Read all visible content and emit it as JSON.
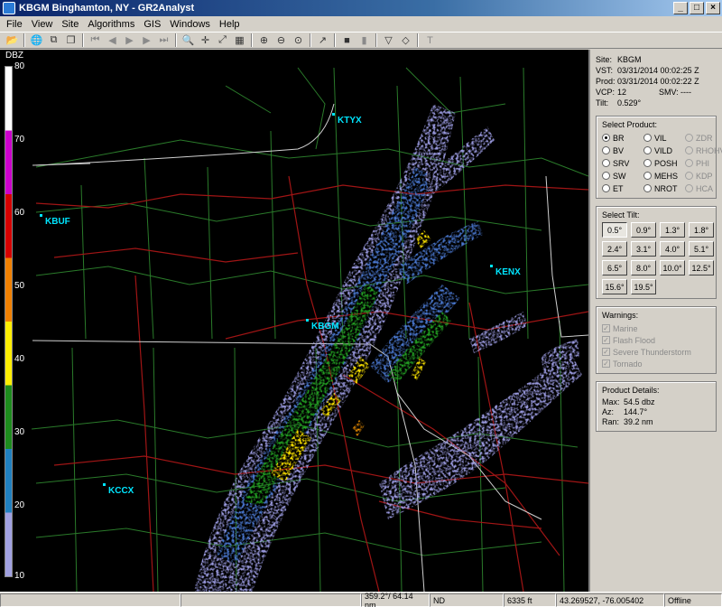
{
  "window": {
    "title": "KBGM Binghamton, NY - GR2Analyst",
    "minimize_glyph": "_",
    "maximize_glyph": "□",
    "close_glyph": "×"
  },
  "menu": [
    "File",
    "View",
    "Site",
    "Algorithms",
    "GIS",
    "Windows",
    "Help"
  ],
  "toolbar": {
    "icons": [
      "open-folder-icon",
      "globe-icon",
      "copy-icon",
      "paste-icon",
      "skip-first-icon",
      "step-back-icon",
      "play-icon",
      "step-forward-icon",
      "skip-last-icon",
      "magnifier-icon",
      "pan-crosshair-icon",
      "measure-icon",
      "layers-icon",
      "zoom-in-icon",
      "zoom-out-icon",
      "zoom-reset-icon",
      "pointer-icon",
      "record-icon",
      "film-icon",
      "triangle-icon",
      "diamond-icon",
      "text-tool-icon"
    ],
    "glyphs": [
      "📂",
      "🌐",
      "⧉",
      "❐",
      "⏮",
      "◀",
      "▶",
      "▶",
      "⏭",
      "🔍",
      "✛",
      "⤢",
      "▦",
      "⊕",
      "⊖",
      "⊙",
      "↗",
      "■",
      "▮",
      "▽",
      "◇",
      "T"
    ]
  },
  "legend": {
    "title": "DBZ",
    "ticks": [
      "80",
      "70",
      "60",
      "50",
      "40",
      "30",
      "20",
      "10"
    ]
  },
  "map": {
    "sites": [
      {
        "id": "KTYX",
        "label": "KTYX"
      },
      {
        "id": "KBUF",
        "label": "KBUF"
      },
      {
        "id": "KENX",
        "label": "KENX"
      },
      {
        "id": "KBGM",
        "label": "KBGM"
      },
      {
        "id": "KCCX",
        "label": "KCCX"
      }
    ]
  },
  "info": {
    "site_label": "Site:",
    "site": "KBGM",
    "vst_label": "VST:",
    "vst": "03/31/2014  00:02:25 Z",
    "prod_label": "Prod:",
    "prod": "03/31/2014  00:02:22 Z",
    "vcp_label": "VCP:",
    "vcp": "12",
    "smv_label": "SMV:",
    "smv": "----",
    "tilt_label": "Tilt:",
    "tilt": "0.529°"
  },
  "select_product": {
    "title": "Select Product:",
    "options": [
      {
        "label": "BR",
        "selected": true,
        "enabled": true
      },
      {
        "label": "VIL",
        "selected": false,
        "enabled": true
      },
      {
        "label": "ZDR",
        "selected": false,
        "enabled": false
      },
      {
        "label": "BV",
        "selected": false,
        "enabled": true
      },
      {
        "label": "VILD",
        "selected": false,
        "enabled": true
      },
      {
        "label": "RHOHV",
        "selected": false,
        "enabled": false
      },
      {
        "label": "SRV",
        "selected": false,
        "enabled": true
      },
      {
        "label": "POSH",
        "selected": false,
        "enabled": true
      },
      {
        "label": "PHI",
        "selected": false,
        "enabled": false
      },
      {
        "label": "SW",
        "selected": false,
        "enabled": true
      },
      {
        "label": "MEHS",
        "selected": false,
        "enabled": true
      },
      {
        "label": "KDP",
        "selected": false,
        "enabled": false
      },
      {
        "label": "ET",
        "selected": false,
        "enabled": true
      },
      {
        "label": "NROT",
        "selected": false,
        "enabled": true
      },
      {
        "label": "HCA",
        "selected": false,
        "enabled": false
      }
    ]
  },
  "select_tilt": {
    "title": "Select Tilt:",
    "tilts": [
      "0.5°",
      "0.9°",
      "1.3°",
      "1.8°",
      "2.4°",
      "3.1°",
      "4.0°",
      "5.1°",
      "6.5°",
      "8.0°",
      "10.0°",
      "12.5°",
      "15.6°",
      "19.5°"
    ],
    "active": "0.5°"
  },
  "warnings": {
    "title": "Warnings:",
    "items": [
      "Marine",
      "Flash Flood",
      "Severe Thunderstorm",
      "Tornado"
    ]
  },
  "product_details": {
    "title": "Product Details:",
    "max_label": "Max:",
    "max": "54.5 dbz",
    "az_label": "Az:",
    "az": "144.7°",
    "ran_label": "Ran:",
    "ran": "39.2 nm"
  },
  "status": {
    "cell1": "",
    "cell2": "",
    "azimuth_range": "359.2°/ 64.14 nm",
    "value": "ND",
    "height": "6335 ft",
    "coords": "43.269527, -76.005402",
    "connection": "Offline"
  },
  "colors": {
    "legend_scale": [
      "#ffffff",
      "#cc00cc",
      "#d60000",
      "#f08000",
      "#ffee00",
      "#1d8b1d",
      "#2080c0",
      "#a0a0e0"
    ],
    "site_label": "#00e5ff",
    "roads": "#a01515",
    "borders": "#2a7a2a",
    "state_lines": "#d0d0d0"
  }
}
